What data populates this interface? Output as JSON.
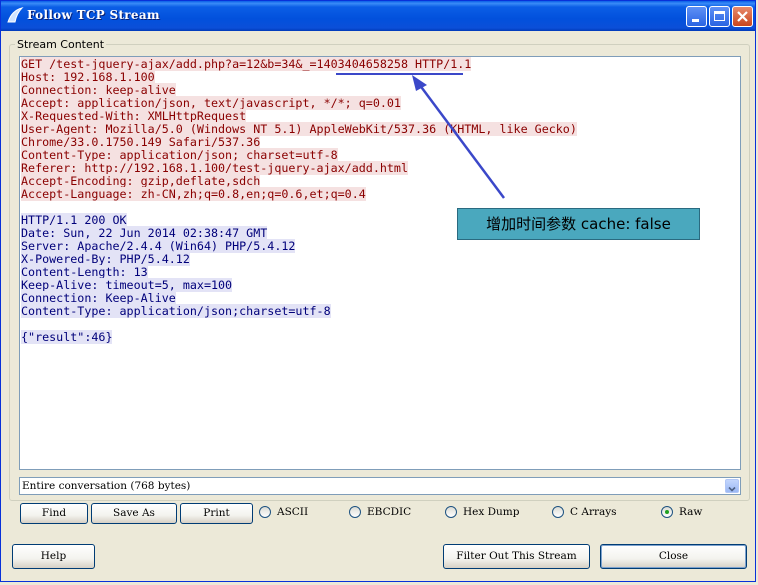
{
  "window": {
    "title": "Follow TCP Stream"
  },
  "stream": {
    "group_label": "Stream Content",
    "request_lines": [
      "GET /test-jquery-ajax/add.php?a=12&b=34&_=1403404658258 HTTP/1.1",
      "Host: 192.168.1.100",
      "Connection: keep-alive",
      "Accept: application/json, text/javascript, */*; q=0.01",
      "X-Requested-With: XMLHttpRequest",
      "User-Agent: Mozilla/5.0 (Windows NT 5.1) AppleWebKit/537.36 (KHTML, like Gecko)",
      "Chrome/33.0.1750.149 Safari/537.36",
      "Content-Type: application/json; charset=utf-8",
      "Referer: http://192.168.1.100/test-jquery-ajax/add.html",
      "Accept-Encoding: gzip,deflate,sdch",
      "Accept-Language: zh-CN,zh;q=0.8,en;q=0.6,et;q=0.4"
    ],
    "response_lines": [
      "HTTP/1.1 200 OK",
      "Date: Sun, 22 Jun 2014 02:38:47 GMT",
      "Server: Apache/2.4.4 (Win64) PHP/5.4.12",
      "X-Powered-By: PHP/5.4.12",
      "Content-Length: 13",
      "Keep-Alive: timeout=5, max=100",
      "Connection: Keep-Alive",
      "Content-Type: application/json;charset=utf-8"
    ],
    "body_line": "{\"result\":46}",
    "annotation": "增加时间参数 cache: false"
  },
  "conversation_select": {
    "value": "Entire conversation (768 bytes)"
  },
  "buttons": {
    "find": "Find",
    "save_as": "Save As",
    "print": "Print",
    "help": "Help",
    "filter_out": "Filter Out This Stream",
    "close": "Close"
  },
  "format_options": [
    {
      "label": "ASCII",
      "selected": false
    },
    {
      "label": "EBCDIC",
      "selected": false
    },
    {
      "label": "Hex Dump",
      "selected": false
    },
    {
      "label": "C Arrays",
      "selected": false
    },
    {
      "label": "Raw",
      "selected": true
    }
  ],
  "colors": {
    "request_text": "#8a0000",
    "request_bg": "#f5e1e1",
    "response_text": "#00007a",
    "response_bg": "#e3e3f6",
    "callout_bg": "#4aa8be",
    "annotation_stroke": "#3b48c9"
  }
}
